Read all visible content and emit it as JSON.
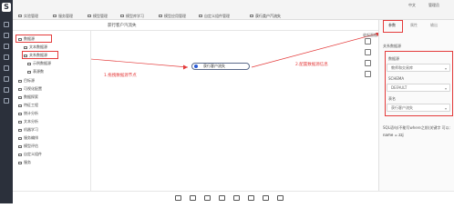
{
  "rail": {
    "logo": "S"
  },
  "topbar": {
    "tabs": [
      "实验管理",
      "服务管理",
      "模型管理",
      "模型库学习",
      "模型应用管理",
      "自定义组件管理",
      "获行类户汽流失"
    ],
    "right": [
      "中文",
      "管理员"
    ]
  },
  "breadcrumb": "获行客户汽流失",
  "tree": {
    "items": [
      "数据源",
      "文本数据源",
      "关系数据源",
      "示例数据源",
      "表源数",
      "目标源",
      "可视化配置",
      "数据探索",
      "特征工程",
      "统计分析",
      "文本分析",
      "机器学习",
      "服务编排",
      "模型评估",
      "自定义组件",
      "服务"
    ]
  },
  "canvas": {
    "node_label": "获行客户流失",
    "annotation_left": "1.拖拽数据源节点",
    "annotation_right": "2.配置数据源信息",
    "collapse_label": "收起面板"
  },
  "panel": {
    "tabs": [
      "参数",
      "属性",
      "输出"
    ],
    "section_title": "关系数据源",
    "fields": [
      {
        "label": "数据源",
        "value": "教师和交易库"
      },
      {
        "label": "SCHEMA",
        "value": "DEFAULT"
      },
      {
        "label": "表名",
        "value": "获行客户流失"
      }
    ],
    "sql_hint": "SQL语句(不能写where之前)关键字 可以:",
    "sql_value": "name = zzj"
  },
  "colors": {
    "accent": "#e43b3b",
    "rail": "#2b303b",
    "node": "#2a5bd7"
  }
}
